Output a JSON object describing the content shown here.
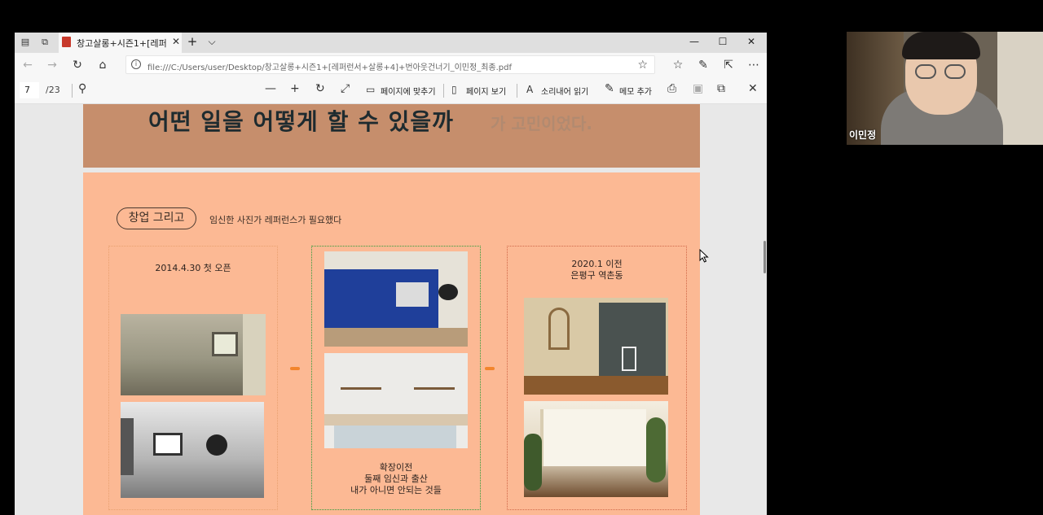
{
  "browser": {
    "tab_title": "창고살롱+시즌1+[레퍼",
    "url": "file:///C:/Users/user/Desktop/창고살롱+시즌1+[레퍼런서+살롱+4]+번아웃건너기_이민정_최종.pdf",
    "tab_close": "✕",
    "new_tab": "+",
    "tab_menu": "⌵",
    "min": "—",
    "max": "☐",
    "close": "✕"
  },
  "pdf_toolbar": {
    "page_current": "7",
    "page_total": "/23",
    "fit_page": "페이지에 맞추기",
    "page_view": "페이지 보기",
    "read_aloud": "소리내어 읽기",
    "add_note": "메모 추가"
  },
  "slide": {
    "headline": "어떤 일을 어떻게 할 수 있을까",
    "headline_tail": "가 고민이었다.",
    "section_pill": "창업 그리고",
    "section_desc": "임신한 사진가 레퍼런스가 필요했다",
    "col1_caption": "2014.4.30 첫 오픈",
    "col2_caption": [
      "확장이전",
      "둘째 임신과 출산",
      "내가 아니면 안되는 것들"
    ],
    "col3_caption": [
      "2020.1 이전",
      "은평구 역촌동"
    ]
  },
  "webcam": {
    "name": "이민정"
  },
  "colors": {
    "slide_top": "#c68e6c",
    "slide_main": "#fcb994",
    "arrow": "#f2852d",
    "col2_border": "#2f9b3a",
    "col1_border": "#e8a070",
    "col3_border": "#d06848"
  }
}
